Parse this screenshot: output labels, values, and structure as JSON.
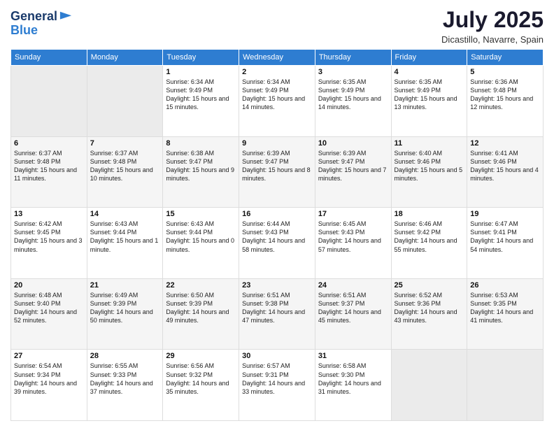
{
  "header": {
    "logo_line1": "General",
    "logo_line2": "Blue",
    "month": "July 2025",
    "location": "Dicastillo, Navarre, Spain"
  },
  "weekdays": [
    "Sunday",
    "Monday",
    "Tuesday",
    "Wednesday",
    "Thursday",
    "Friday",
    "Saturday"
  ],
  "weeks": [
    {
      "days": [
        {
          "num": "",
          "info": "",
          "empty": true
        },
        {
          "num": "",
          "info": "",
          "empty": true
        },
        {
          "num": "1",
          "info": "Sunrise: 6:34 AM\nSunset: 9:49 PM\nDaylight: 15 hours and 15 minutes."
        },
        {
          "num": "2",
          "info": "Sunrise: 6:34 AM\nSunset: 9:49 PM\nDaylight: 15 hours and 14 minutes."
        },
        {
          "num": "3",
          "info": "Sunrise: 6:35 AM\nSunset: 9:49 PM\nDaylight: 15 hours and 14 minutes."
        },
        {
          "num": "4",
          "info": "Sunrise: 6:35 AM\nSunset: 9:49 PM\nDaylight: 15 hours and 13 minutes."
        },
        {
          "num": "5",
          "info": "Sunrise: 6:36 AM\nSunset: 9:48 PM\nDaylight: 15 hours and 12 minutes."
        }
      ]
    },
    {
      "days": [
        {
          "num": "6",
          "info": "Sunrise: 6:37 AM\nSunset: 9:48 PM\nDaylight: 15 hours and 11 minutes."
        },
        {
          "num": "7",
          "info": "Sunrise: 6:37 AM\nSunset: 9:48 PM\nDaylight: 15 hours and 10 minutes."
        },
        {
          "num": "8",
          "info": "Sunrise: 6:38 AM\nSunset: 9:47 PM\nDaylight: 15 hours and 9 minutes."
        },
        {
          "num": "9",
          "info": "Sunrise: 6:39 AM\nSunset: 9:47 PM\nDaylight: 15 hours and 8 minutes."
        },
        {
          "num": "10",
          "info": "Sunrise: 6:39 AM\nSunset: 9:47 PM\nDaylight: 15 hours and 7 minutes."
        },
        {
          "num": "11",
          "info": "Sunrise: 6:40 AM\nSunset: 9:46 PM\nDaylight: 15 hours and 5 minutes."
        },
        {
          "num": "12",
          "info": "Sunrise: 6:41 AM\nSunset: 9:46 PM\nDaylight: 15 hours and 4 minutes."
        }
      ]
    },
    {
      "days": [
        {
          "num": "13",
          "info": "Sunrise: 6:42 AM\nSunset: 9:45 PM\nDaylight: 15 hours and 3 minutes."
        },
        {
          "num": "14",
          "info": "Sunrise: 6:43 AM\nSunset: 9:44 PM\nDaylight: 15 hours and 1 minute."
        },
        {
          "num": "15",
          "info": "Sunrise: 6:43 AM\nSunset: 9:44 PM\nDaylight: 15 hours and 0 minutes."
        },
        {
          "num": "16",
          "info": "Sunrise: 6:44 AM\nSunset: 9:43 PM\nDaylight: 14 hours and 58 minutes."
        },
        {
          "num": "17",
          "info": "Sunrise: 6:45 AM\nSunset: 9:43 PM\nDaylight: 14 hours and 57 minutes."
        },
        {
          "num": "18",
          "info": "Sunrise: 6:46 AM\nSunset: 9:42 PM\nDaylight: 14 hours and 55 minutes."
        },
        {
          "num": "19",
          "info": "Sunrise: 6:47 AM\nSunset: 9:41 PM\nDaylight: 14 hours and 54 minutes."
        }
      ]
    },
    {
      "days": [
        {
          "num": "20",
          "info": "Sunrise: 6:48 AM\nSunset: 9:40 PM\nDaylight: 14 hours and 52 minutes."
        },
        {
          "num": "21",
          "info": "Sunrise: 6:49 AM\nSunset: 9:39 PM\nDaylight: 14 hours and 50 minutes."
        },
        {
          "num": "22",
          "info": "Sunrise: 6:50 AM\nSunset: 9:39 PM\nDaylight: 14 hours and 49 minutes."
        },
        {
          "num": "23",
          "info": "Sunrise: 6:51 AM\nSunset: 9:38 PM\nDaylight: 14 hours and 47 minutes."
        },
        {
          "num": "24",
          "info": "Sunrise: 6:51 AM\nSunset: 9:37 PM\nDaylight: 14 hours and 45 minutes."
        },
        {
          "num": "25",
          "info": "Sunrise: 6:52 AM\nSunset: 9:36 PM\nDaylight: 14 hours and 43 minutes."
        },
        {
          "num": "26",
          "info": "Sunrise: 6:53 AM\nSunset: 9:35 PM\nDaylight: 14 hours and 41 minutes."
        }
      ]
    },
    {
      "days": [
        {
          "num": "27",
          "info": "Sunrise: 6:54 AM\nSunset: 9:34 PM\nDaylight: 14 hours and 39 minutes."
        },
        {
          "num": "28",
          "info": "Sunrise: 6:55 AM\nSunset: 9:33 PM\nDaylight: 14 hours and 37 minutes."
        },
        {
          "num": "29",
          "info": "Sunrise: 6:56 AM\nSunset: 9:32 PM\nDaylight: 14 hours and 35 minutes."
        },
        {
          "num": "30",
          "info": "Sunrise: 6:57 AM\nSunset: 9:31 PM\nDaylight: 14 hours and 33 minutes."
        },
        {
          "num": "31",
          "info": "Sunrise: 6:58 AM\nSunset: 9:30 PM\nDaylight: 14 hours and 31 minutes."
        },
        {
          "num": "",
          "info": "",
          "empty": true
        },
        {
          "num": "",
          "info": "",
          "empty": true
        }
      ]
    }
  ]
}
